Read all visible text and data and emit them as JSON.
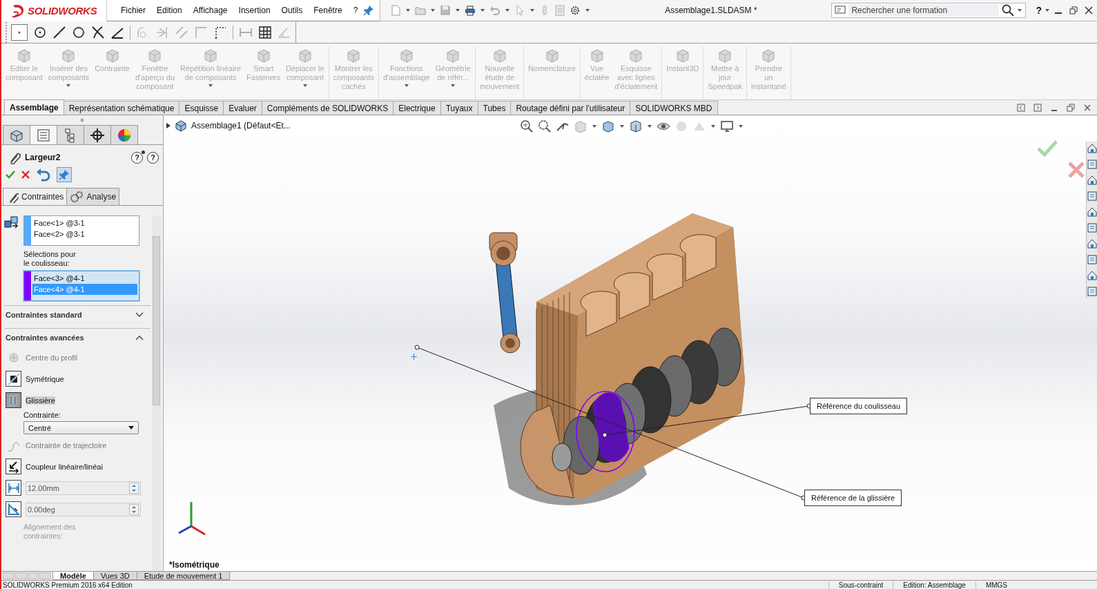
{
  "title_bar": {
    "logo": "SOLIDWORKS",
    "menu": [
      "Fichier",
      "Edition",
      "Affichage",
      "Insertion",
      "Outils",
      "Fenêtre",
      "?"
    ],
    "document_title": "Assemblage1.SLDASM *",
    "search": {
      "placeholder": "Rechercher une formation"
    },
    "help": "?"
  },
  "command_groups": [
    {
      "buttons": [
        {
          "label": "Editer le\ncomposant",
          "disabled": true,
          "dropdown": false
        },
        {
          "label": "Insérer des\ncomposants",
          "disabled": true,
          "dropdown": true
        },
        {
          "label": "Contrainte",
          "disabled": true,
          "dropdown": false
        },
        {
          "label": "Fenêtre\nd'aperçu du\ncomposant",
          "disabled": true,
          "dropdown": false
        },
        {
          "label": "Répétition linéaire\nde composants",
          "disabled": true,
          "dropdown": true
        },
        {
          "label": "Smart\nFasteners",
          "disabled": true,
          "dropdown": false
        },
        {
          "label": "Déplacer le\ncomposant",
          "disabled": true,
          "dropdown": true
        }
      ]
    },
    {
      "buttons": [
        {
          "label": "Montrer les\ncomposants\ncachés",
          "disabled": true,
          "dropdown": false
        }
      ]
    },
    {
      "buttons": [
        {
          "label": "Fonctions\nd'assemblage",
          "disabled": true,
          "dropdown": true
        },
        {
          "label": "Géométrie\nde référ...",
          "disabled": true,
          "dropdown": true
        }
      ]
    },
    {
      "buttons": [
        {
          "label": "Nouvelle\nétude de\nmouvement",
          "disabled": true,
          "dropdown": false
        }
      ]
    },
    {
      "buttons": [
        {
          "label": "Nomenclature",
          "disabled": true,
          "dropdown": false
        }
      ]
    },
    {
      "buttons": [
        {
          "label": "Vue\néclatée",
          "disabled": true,
          "dropdown": false
        },
        {
          "label": "Esquisse\navec lignes\nd'éclatement",
          "disabled": true,
          "dropdown": false
        }
      ]
    },
    {
      "buttons": [
        {
          "label": "Instant3D",
          "disabled": true,
          "dropdown": false
        }
      ]
    },
    {
      "buttons": [
        {
          "label": "Mettre à\njour\nSpeedpak",
          "disabled": true,
          "dropdown": false
        }
      ]
    },
    {
      "buttons": [
        {
          "label": "Prendre\nun\ninstantané",
          "disabled": true,
          "dropdown": false
        }
      ]
    }
  ],
  "tabs": [
    {
      "label": "Assemblage",
      "selected": true
    },
    {
      "label": "Représentation schématique",
      "selected": false
    },
    {
      "label": "Esquisse",
      "selected": false
    },
    {
      "label": "Evaluer",
      "selected": false
    },
    {
      "label": "Compléments de SOLIDWORKS",
      "selected": false
    },
    {
      "label": "Electrique",
      "selected": false
    },
    {
      "label": "Tuyaux",
      "selected": false
    },
    {
      "label": "Tubes",
      "selected": false
    },
    {
      "label": "Routage défini par l'utilisateur",
      "selected": false
    },
    {
      "label": "SOLIDWORKS MBD",
      "selected": false
    }
  ],
  "panel_tabs": [
    {
      "selected": false
    },
    {
      "selected": true
    },
    {
      "selected": false
    },
    {
      "selected": false
    },
    {
      "selected": false
    }
  ],
  "property_manager": {
    "title": "Largeur2",
    "subtabs": [
      {
        "label": "Contraintes",
        "selected": true
      },
      {
        "label": "Analyse",
        "selected": false
      }
    ],
    "help_buttons": [
      "?",
      "?"
    ],
    "selection_boxes": [
      {
        "color": "#55aaff",
        "active": false,
        "items": [
          {
            "text": "Face<1> @3-1",
            "selected": false
          },
          {
            "text": "Face<2> @3-1",
            "selected": false
          }
        ]
      },
      {
        "label": "Sélections pour\nle coulisseau:",
        "color": "#8000ff",
        "active": true,
        "items": [
          {
            "text": "Face<3> @4-1",
            "selected": false
          },
          {
            "text": "Face<4> @4-1",
            "selected": true
          }
        ]
      }
    ],
    "sections": [
      {
        "title": "Contraintes standard",
        "expanded": false
      },
      {
        "title": "Contraintes avancées",
        "expanded": true,
        "items": [
          {
            "kind": "option",
            "label": "Centre du profil",
            "disabled": true,
            "selected": false
          },
          {
            "kind": "option",
            "label": "Symétrique",
            "disabled": false,
            "selected": false
          },
          {
            "kind": "option",
            "label": "Glissière",
            "disabled": false,
            "selected": true
          },
          {
            "kind": "label",
            "label": "Contrainte:"
          },
          {
            "kind": "dropdown",
            "value": "Centré"
          },
          {
            "kind": "option",
            "label": "Contrainte de trajectoire",
            "disabled": true,
            "selected": false
          },
          {
            "kind": "option",
            "label": "Coupleur linéaire/linéai",
            "disabled": false,
            "selected": false
          },
          {
            "kind": "number",
            "value": "12.00mm"
          },
          {
            "kind": "number",
            "value": "0.00deg"
          },
          {
            "kind": "note",
            "label": "Alignement des\ncontraintes:"
          }
        ]
      }
    ]
  },
  "viewport": {
    "tree_item": "Assemblage1  (Défaut<Et...",
    "view_label": "*Isométrique",
    "callouts": [
      "Référence du coulisseau",
      "Référence de la glissière"
    ]
  },
  "bottom_tabs": [
    {
      "label": "Modèle",
      "selected": true
    },
    {
      "label": "Vues 3D",
      "selected": false
    },
    {
      "label": "Etude de mouvement 1",
      "selected": false
    }
  ],
  "status_bar": {
    "product": "SOLIDWORKS Premium 2016 x64 Edition",
    "fields": [
      "Sous-contraint",
      "Edition: Assemblage",
      "MMGS"
    ]
  }
}
